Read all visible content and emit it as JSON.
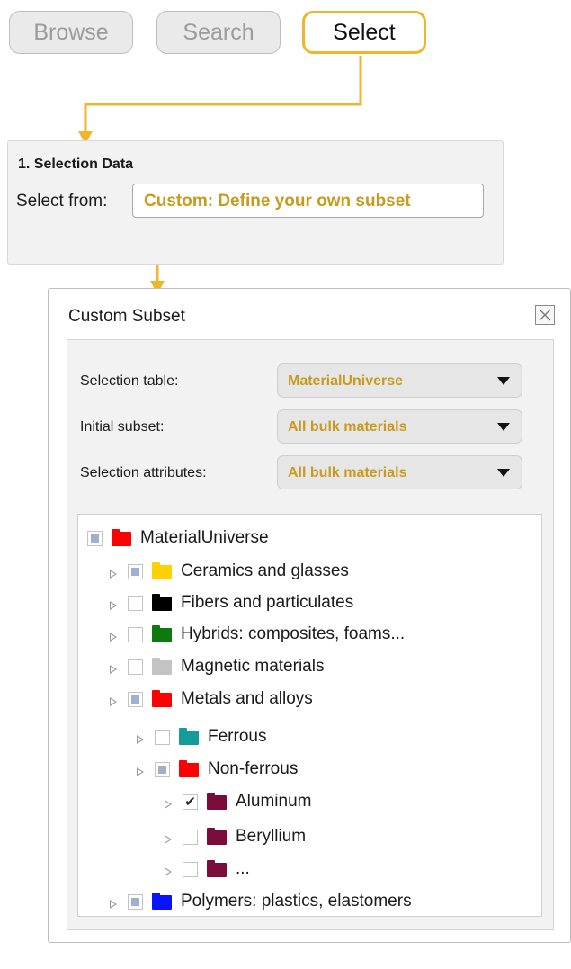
{
  "modes": {
    "browse": "Browse",
    "search": "Search",
    "select": "Select",
    "active": "Select"
  },
  "colors": {
    "accent": "#f1b52c",
    "highlight_text": "#c99a1d"
  },
  "selection_panel": {
    "heading": "1. Selection Data",
    "select_from_label": "Select from:",
    "select_from_value": "Custom: Define your own subset"
  },
  "dialog": {
    "title": "Custom Subset",
    "close_icon": "close-icon",
    "fields": {
      "selection_table": {
        "label": "Selection table:",
        "value": "MaterialUniverse"
      },
      "initial_subset": {
        "label": "Initial subset:",
        "value": "All bulk materials"
      },
      "selection_attributes": {
        "label": "Selection attributes:",
        "value": "All bulk materials"
      }
    },
    "tree": [
      {
        "label": "MaterialUniverse",
        "state": "partial",
        "color": "#ff0000",
        "expander": false
      },
      {
        "label": "Ceramics and glasses",
        "state": "partial",
        "color": "#ffd100",
        "expander": true
      },
      {
        "label": "Fibers and particulates",
        "state": "unchecked",
        "color": "#000000",
        "expander": true
      },
      {
        "label": "Hybrids: composites, foams...",
        "state": "unchecked",
        "color": "#0d7a0d",
        "expander": true
      },
      {
        "label": "Magnetic materials",
        "state": "unchecked",
        "color": "#c3c3c3",
        "expander": true
      },
      {
        "label": "Metals and alloys",
        "state": "partial",
        "color": "#ff0000",
        "expander": true
      },
      {
        "label": "Ferrous",
        "state": "unchecked",
        "color": "#169b9b",
        "expander": true
      },
      {
        "label": "Non-ferrous",
        "state": "partial",
        "color": "#ff0000",
        "expander": true
      },
      {
        "label": "Aluminum",
        "state": "checked",
        "color": "#7a0b3a",
        "expander": true
      },
      {
        "label": "Beryllium",
        "state": "unchecked",
        "color": "#7a0b3a",
        "expander": true
      },
      {
        "label": "...",
        "state": "unchecked",
        "color": "#7a0b3a",
        "expander": true
      },
      {
        "label": "Polymers: plastics, elastomers",
        "state": "partial",
        "color": "#0a13ff",
        "expander": true
      }
    ]
  }
}
